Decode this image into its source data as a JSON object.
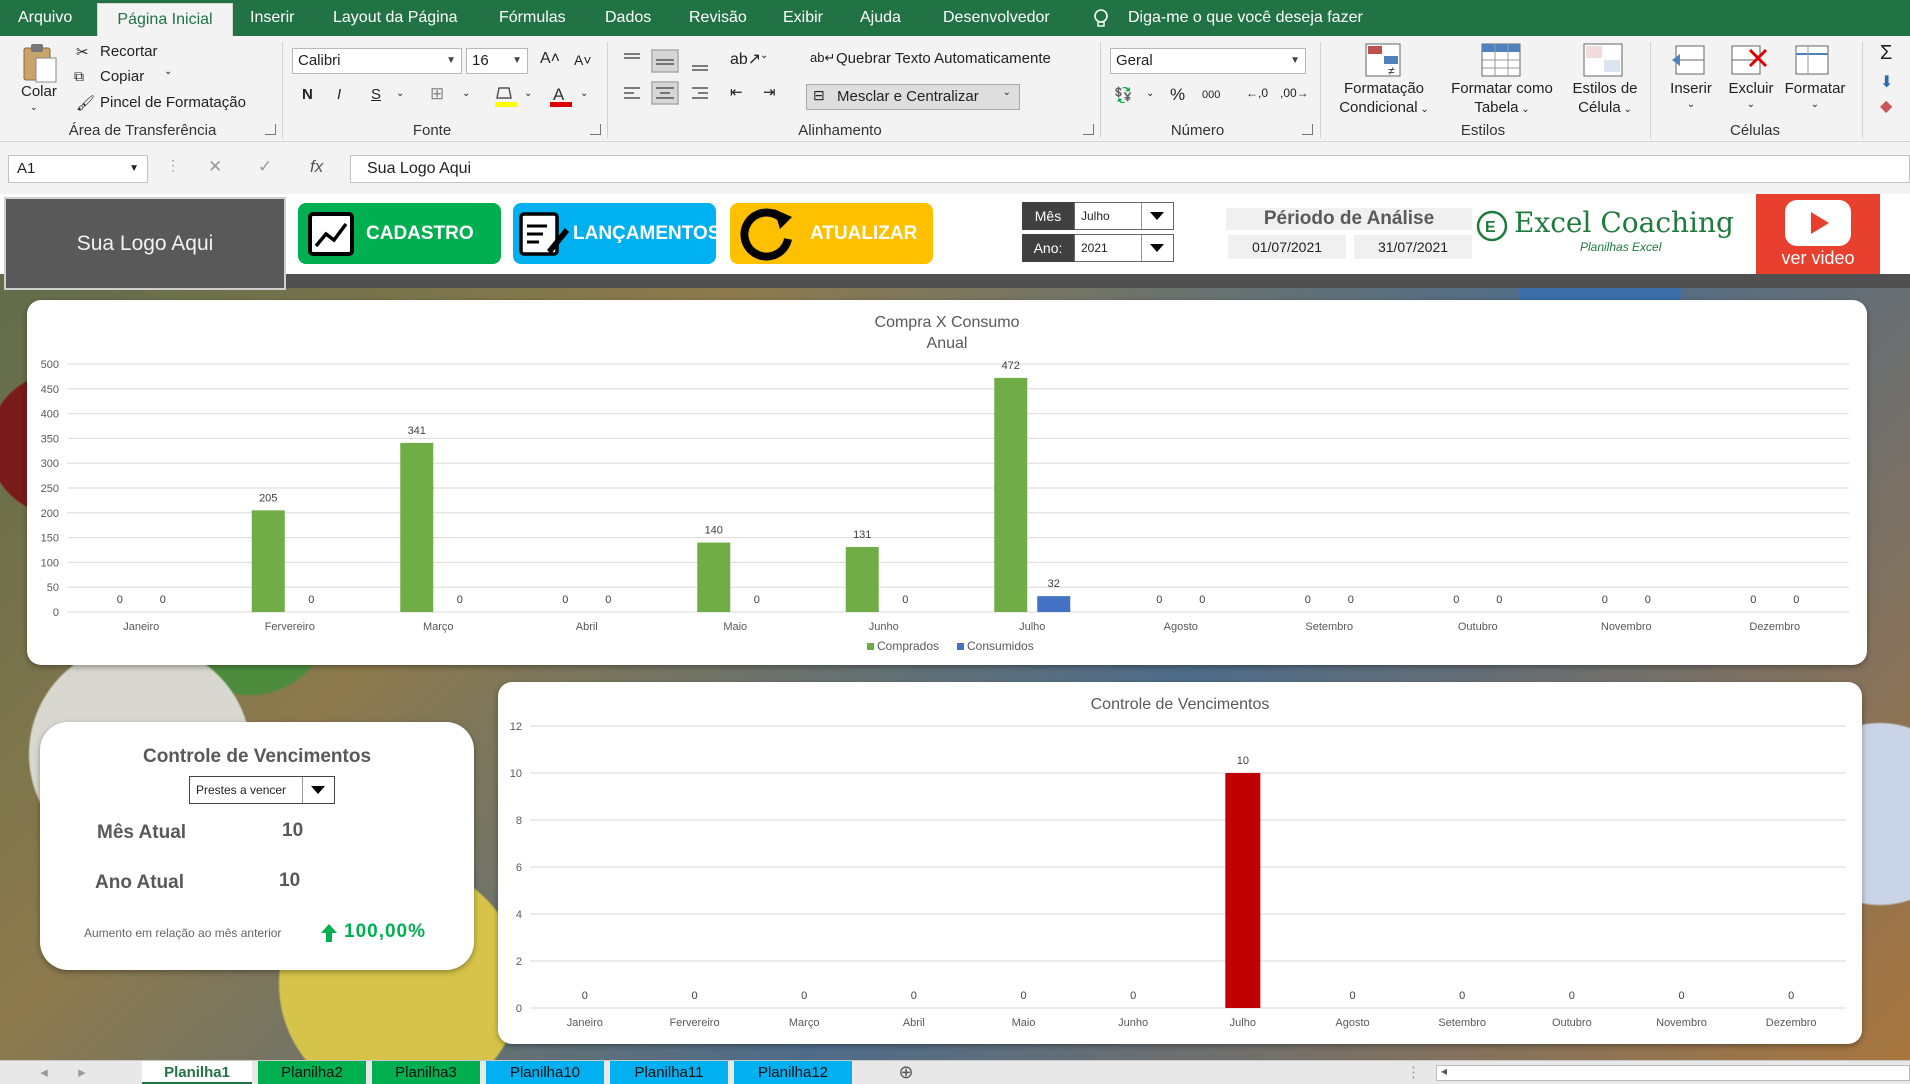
{
  "ribbon_tabs": [
    "Arquivo",
    "Página Inicial",
    "Inserir",
    "Layout da Página",
    "Fórmulas",
    "Dados",
    "Revisão",
    "Exibir",
    "Ajuda",
    "Desenvolvedor"
  ],
  "tell_me": "Diga-me o que você deseja fazer",
  "clipboard": {
    "paste": "Colar",
    "cut": "Recortar",
    "copy": "Copiar",
    "painter": "Pincel de Formatação",
    "group": "Área de Transferência"
  },
  "font": {
    "name": "Calibri",
    "size": "16",
    "bold": "N",
    "italic": "I",
    "underline": "S",
    "group": "Fonte"
  },
  "alignment": {
    "wrap": "Quebrar Texto Automaticamente",
    "merge": "Mesclar e Centralizar",
    "group": "Alinhamento"
  },
  "number": {
    "format": "Geral",
    "percent": "%",
    "thousands": "000",
    "group": "Número"
  },
  "styles": {
    "conditional_1": "Formatação",
    "conditional_2": "Condicional",
    "table_1": "Formatar como",
    "table_2": "Tabela",
    "cell_1": "Estilos de",
    "cell_2": "Célula",
    "group": "Estilos"
  },
  "cells": {
    "insert": "Inserir",
    "delete": "Excluir",
    "format": "Formatar",
    "group": "Células"
  },
  "formula_bar": {
    "name_box": "A1",
    "fx": "fx",
    "content": "Sua Logo Aqui"
  },
  "dashboard": {
    "logo": "Sua Logo Aqui",
    "buttons": {
      "cadastro": "CADASTRO",
      "lancamentos": "LANÇAMENTOS",
      "atualizar": "ATUALIZAR"
    },
    "mes_label": "Mês",
    "mes_value": "Julho",
    "ano_label": "Ano:",
    "ano_value": "2021",
    "periodo_title": "Périodo de Análise",
    "date_start": "01/07/2021",
    "date_end": "31/07/2021",
    "brand": "Excel Coaching",
    "brand_sub": "Planilhas Excel",
    "video": "ver video",
    "colors": {
      "green": "#00b050",
      "blue": "#00b0f0",
      "yellow": "#ffc000",
      "youtube": "#e8402f",
      "bar_green": "#70ad47",
      "bar_blue": "#4472c4",
      "bar_red": "#c00000"
    }
  },
  "kpi": {
    "title": "Controle de Vencimentos",
    "select": "Prestes a vencer",
    "mes_label": "Mês Atual",
    "mes_value": "10",
    "ano_label": "Ano Atual",
    "ano_value": "10",
    "growth_label": "Aumento em relação ao mês anterior",
    "growth_value": "100,00%"
  },
  "chart_data": [
    {
      "type": "bar",
      "title": "Compra X Consumo",
      "subtitle": "Anual",
      "categories": [
        "Janeiro",
        "Fervereiro",
        "Março",
        "Abril",
        "Maio",
        "Junho",
        "Julho",
        "Agosto",
        "Setembro",
        "Outubro",
        "Novembro",
        "Dezembro"
      ],
      "series": [
        {
          "name": "Comprados",
          "color": "#70ad47",
          "values": [
            0,
            205,
            341,
            0,
            140,
            131,
            472,
            0,
            0,
            0,
            0,
            0
          ]
        },
        {
          "name": "Consumidos",
          "color": "#4472c4",
          "values": [
            0,
            0,
            0,
            0,
            0,
            0,
            32,
            0,
            0,
            0,
            0,
            0
          ]
        }
      ],
      "ylim": [
        0,
        500
      ],
      "yticks": [
        0,
        50,
        100,
        150,
        200,
        250,
        300,
        350,
        400,
        450,
        500
      ],
      "grid": true,
      "legend": "bottom"
    },
    {
      "type": "bar",
      "title": "Controle de Vencimentos",
      "categories": [
        "Janeiro",
        "Fervereiro",
        "Março",
        "Abril",
        "Maio",
        "Junho",
        "Julho",
        "Agosto",
        "Setembro",
        "Outubro",
        "Novembro",
        "Dezembro"
      ],
      "series": [
        {
          "color": "#c00000",
          "values": [
            0,
            0,
            0,
            0,
            0,
            0,
            10,
            0,
            0,
            0,
            0,
            0
          ]
        }
      ],
      "ylim": [
        0,
        12
      ],
      "yticks": [
        0,
        2,
        4,
        6,
        8,
        10,
        12
      ],
      "grid": true,
      "legend": "none"
    }
  ],
  "sheets": [
    "Planilha1",
    "Planilha2",
    "Planilha3",
    "Planilha10",
    "Planilha11",
    "Planilha12"
  ]
}
